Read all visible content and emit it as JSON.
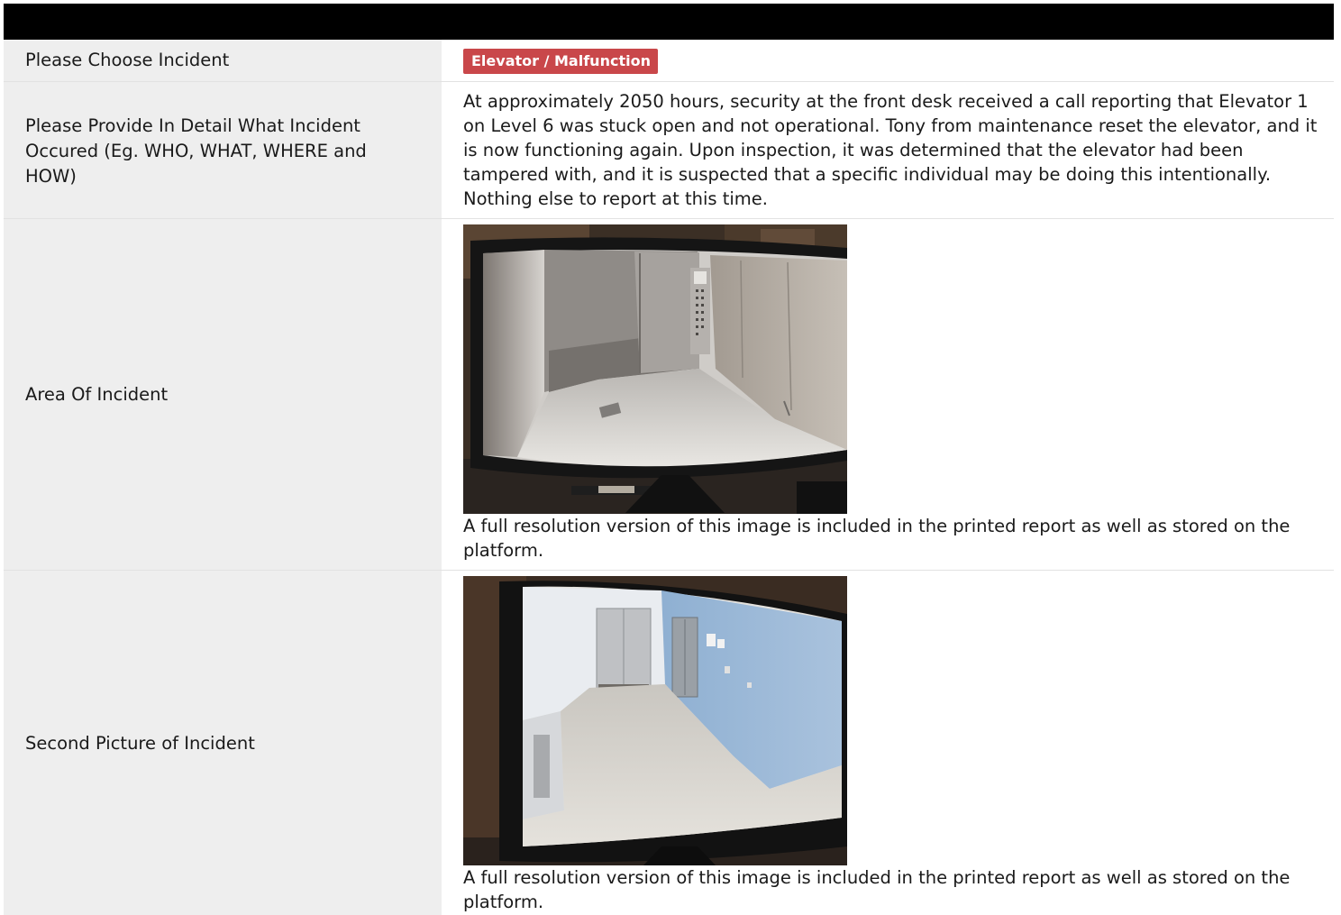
{
  "rows": [
    {
      "label": "Please Choose Incident",
      "badge": "Elevator / Malfunction",
      "badge_color": "#c9474a"
    },
    {
      "label": "Please Provide In Detail What Incident Occured (Eg. WHO, WHAT, WHERE and HOW)",
      "value": "At approximately 2050 hours, security at the front desk received a call reporting that Elevator 1 on Level 6 was stuck open and not operational. Tony from maintenance reset the elevator, and it is now functioning again. Upon inspection, it was determined that the elevator had been tampered with, and it is suspected that a specific individual may be doing this intentionally. Nothing else to report at this time."
    },
    {
      "label": "Area Of Incident",
      "caption": "A full resolution version of this image is included in the printed report as well as stored on the platform."
    },
    {
      "label": "Second Picture of Incident",
      "caption": "A full resolution version of this image is included in the printed report as well as stored on the platform."
    }
  ]
}
